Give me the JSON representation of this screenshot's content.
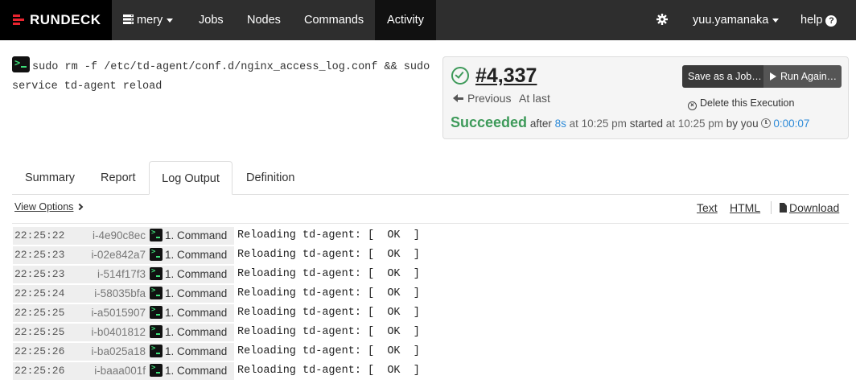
{
  "navbar": {
    "brand": "RUNDECK",
    "project": "mery",
    "items": [
      "Jobs",
      "Nodes",
      "Commands",
      "Activity"
    ],
    "user": "yuu.yamanaka",
    "help": "help"
  },
  "command": {
    "text": "sudo rm -f /etc/td-agent/conf.d/nginx_access_log.conf && sudo service td-agent reload"
  },
  "execution": {
    "id": "#4,337",
    "save_as_job": "Save as a Job…",
    "run_again": "Run Again…",
    "previous": "Previous",
    "at_last": "At last",
    "delete": "Delete this Execution",
    "status": "Succeeded",
    "after": "after",
    "duration_short": "8s",
    "at_1": "at 10:25 pm",
    "started": "started",
    "at_2": "at 10:25 pm",
    "by_you": "by you",
    "duration": "0:00:07"
  },
  "tabs": [
    "Summary",
    "Report",
    "Log Output",
    "Definition"
  ],
  "log_options": {
    "view_options": "View Options",
    "text": "Text",
    "html": "HTML",
    "download": "Download"
  },
  "log": [
    {
      "time": "22:25:22",
      "node": "i-4e90c8ec",
      "step": "1. Command",
      "msg": "Reloading td-agent: [  OK  ]"
    },
    {
      "time": "22:25:23",
      "node": "i-02e842a7",
      "step": "1. Command",
      "msg": "Reloading td-agent: [  OK  ]"
    },
    {
      "time": "22:25:23",
      "node": "i-514f17f3",
      "step": "1. Command",
      "msg": "Reloading td-agent: [  OK  ]"
    },
    {
      "time": "22:25:24",
      "node": "i-58035bfa",
      "step": "1. Command",
      "msg": "Reloading td-agent: [  OK  ]"
    },
    {
      "time": "22:25:25",
      "node": "i-a5015907",
      "step": "1. Command",
      "msg": "Reloading td-agent: [  OK  ]"
    },
    {
      "time": "22:25:25",
      "node": "i-b0401812",
      "step": "1. Command",
      "msg": "Reloading td-agent: [  OK  ]"
    },
    {
      "time": "22:25:26",
      "node": "i-ba025a18",
      "step": "1. Command",
      "msg": "Reloading td-agent: [  OK  ]"
    },
    {
      "time": "22:25:26",
      "node": "i-baaa001f",
      "step": "1. Command",
      "msg": "Reloading td-agent: [  OK  ]"
    }
  ],
  "colors": {
    "navbar": "#2e2e2e",
    "brand_bg": "#000000",
    "brand_accent": "#e8242f",
    "success": "#3e9a5a",
    "link_blue": "#2e8bd8"
  }
}
